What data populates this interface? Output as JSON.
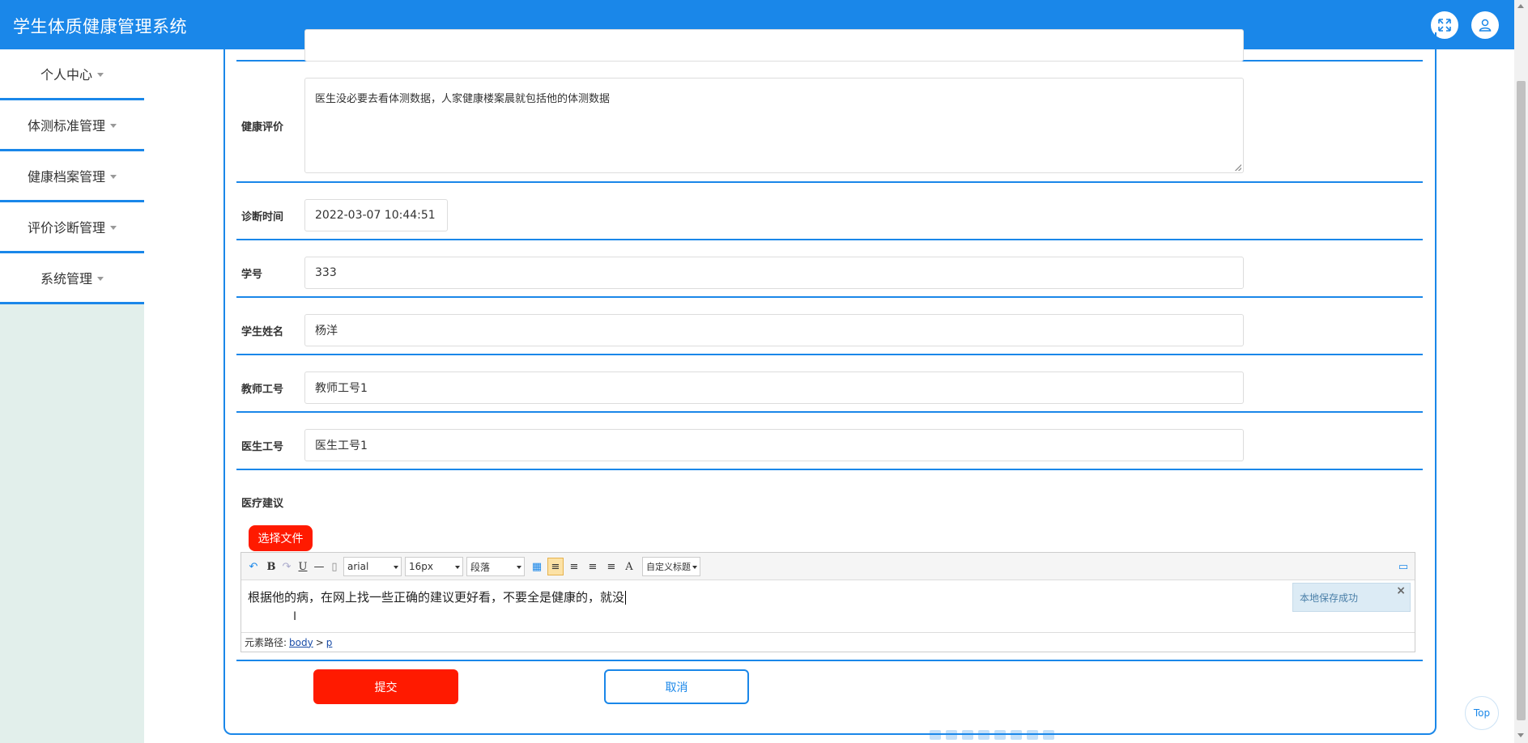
{
  "header": {
    "title": "学生体质健康管理系统",
    "fullscreen_icon": "fullscreen-icon",
    "user_icon": "user-icon"
  },
  "sidebar": {
    "items": [
      {
        "label": "个人中心"
      },
      {
        "label": "体测标准管理"
      },
      {
        "label": "健康档案管理"
      },
      {
        "label": "评价诊断管理"
      },
      {
        "label": "系统管理"
      }
    ]
  },
  "form": {
    "health_eval": {
      "label": "健康评价",
      "value": "医生没必要去看体测数据，人家健康楼案晨就包括他的体测数据"
    },
    "diag_time": {
      "label": "诊断时间",
      "value": "2022-03-07 10:44:51"
    },
    "student_no": {
      "label": "学号",
      "value": "333"
    },
    "student_name": {
      "label": "学生姓名",
      "value": "杨洋"
    },
    "teacher_no": {
      "label": "教师工号",
      "value": "教师工号1"
    },
    "doctor_no": {
      "label": "医生工号",
      "value": "医生工号1"
    },
    "medical_advice": {
      "label": "医疗建议"
    }
  },
  "editor": {
    "file_button": "选择文件",
    "font": "arial",
    "size": "16px",
    "paragraph": "段落",
    "custom_title": "自定义标题",
    "content": "根据他的病，在网上找一些正确的建议更好看，不要全是健康的，就没",
    "save_tip": "本地保存成功",
    "save_tip_close": "×",
    "path_label": "元素路径:",
    "path_body": "body",
    "path_sep": ">",
    "path_p": "p",
    "ibeam": "I"
  },
  "actions": {
    "submit": "提交",
    "cancel": "取消",
    "top": "Top"
  },
  "colors": {
    "primary": "#1a87e9",
    "danger": "#ff1a00",
    "sidebar_bg": "#e2efeb"
  }
}
